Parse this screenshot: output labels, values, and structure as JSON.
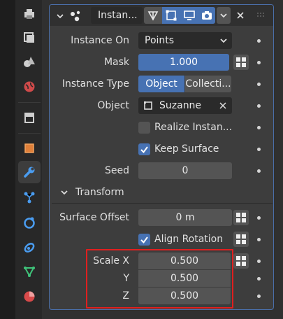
{
  "modifier": {
    "name": "Instan...",
    "icons": [
      "drag-dots-icon",
      "node-geometry-icon"
    ],
    "toggles": [
      "edit-mode-icon",
      "on-cage-icon",
      "realtime-icon",
      "render-icon"
    ]
  },
  "fields": {
    "instance_on": {
      "label": "Instance On",
      "value": "Points"
    },
    "mask": {
      "label": "Mask",
      "value": "1.000"
    },
    "instance_type": {
      "label": "Instance Type",
      "options": [
        "Object",
        "Collecti..."
      ],
      "selected": "Object"
    },
    "object": {
      "label": "Object",
      "value": "Suzanne"
    },
    "realize_instances": {
      "label": "Realize Instan...",
      "checked": false
    },
    "keep_surface": {
      "label": "Keep Surface",
      "checked": true
    },
    "seed": {
      "label": "Seed",
      "value": "0"
    }
  },
  "transform": {
    "header": "Transform",
    "surface_offset": {
      "label": "Surface Offset",
      "value": "0 m"
    },
    "align_rotation": {
      "label": "Align Rotation",
      "checked": true
    },
    "scale_x": {
      "label": "Scale X",
      "value": "0.500"
    },
    "scale_y": {
      "label": "Y",
      "value": "0.500"
    },
    "scale_z": {
      "label": "Z",
      "value": "0.500"
    }
  },
  "colors": {
    "accent": "#4772b3",
    "highlight": "#e01f1f",
    "background": "#3d3d3d"
  }
}
